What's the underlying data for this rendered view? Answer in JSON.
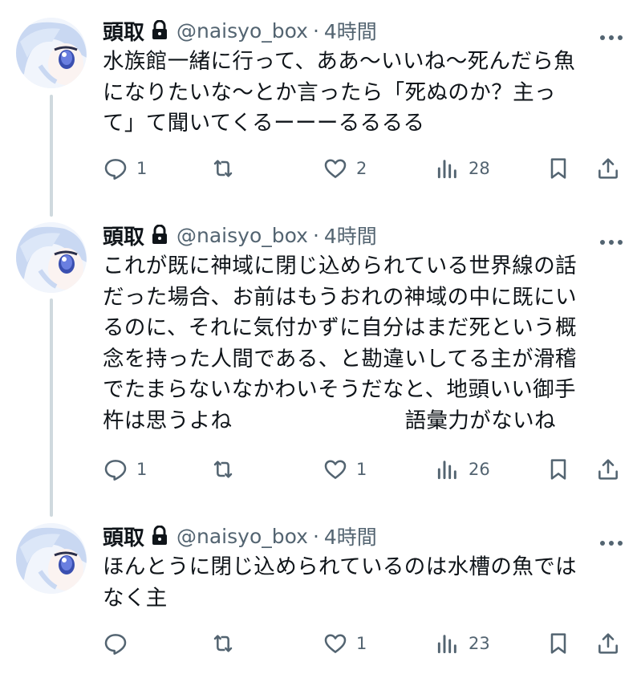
{
  "tweets": [
    {
      "name": "頭取",
      "handle": "@naisyo_box",
      "sep": "·",
      "time": "4時間",
      "text": "水族館一緒に行って、ああ〜いいね〜死んだら魚\nになりたいな〜とか言ったら「死ぬのか？主っ\nて」て聞いてくるーーーるるるる",
      "replies": "1",
      "retweets": "",
      "likes": "2",
      "views": "28"
    },
    {
      "name": "頭取",
      "handle": "@naisyo_box",
      "sep": "·",
      "time": "4時間",
      "text": "これが既に神域に閉じ込められている世界線の話\nだった場合、お前はもうおれの神域の中に既にい\nるのに、それに気付かずに自分はまだ死という概\n念を持った人間である、と勘違いしてる主が滑稽\nでたまらないなかわいそうだなと、地頭いい御手\n杵は思うよね　　　　　　　　語彙力がないね",
      "replies": "1",
      "retweets": "",
      "likes": "1",
      "views": "26"
    },
    {
      "name": "頭取",
      "handle": "@naisyo_box",
      "sep": "·",
      "time": "4時間",
      "text": "ほんとうに閉じ込められているのは水槽の魚では\nなく主",
      "replies": "",
      "retweets": "",
      "likes": "1",
      "views": "23"
    }
  ],
  "icons": {
    "lock": "lock-icon",
    "more": "more-icon",
    "reply": "reply-icon",
    "retweet": "retweet-icon",
    "like": "heart-icon",
    "views": "views-icon",
    "bookmark": "bookmark-icon",
    "share": "share-icon"
  },
  "colors": {
    "secondary_text": "#536471",
    "thread_line": "#cfd9de",
    "text": "#0f1419"
  }
}
